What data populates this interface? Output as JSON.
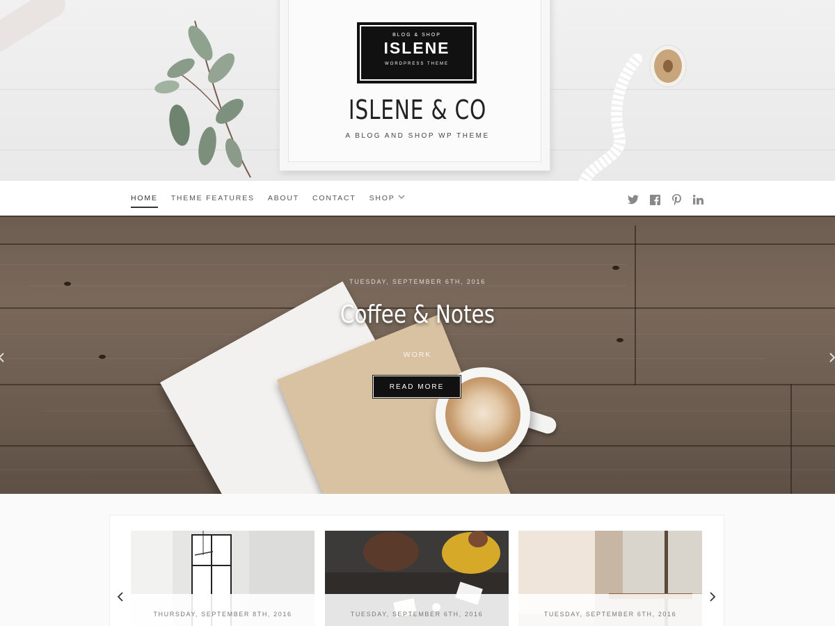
{
  "header": {
    "logo": {
      "top": "BLOG & SHOP",
      "main": "ISLENE",
      "bottom": "WORDPRESS THEME"
    },
    "site_title": "ISLENE & CO",
    "tagline": "A BLOG AND SHOP WP THEME"
  },
  "nav": {
    "items": [
      {
        "label": "HOME",
        "active": true
      },
      {
        "label": "THEME FEATURES",
        "active": false
      },
      {
        "label": "ABOUT",
        "active": false
      },
      {
        "label": "CONTACT",
        "active": false
      },
      {
        "label": "SHOP",
        "active": false,
        "has_dropdown": true
      }
    ],
    "social": [
      "twitter-icon",
      "facebook-icon",
      "pinterest-icon",
      "linkedin-icon"
    ]
  },
  "hero": {
    "date": "TUESDAY, SEPTEMBER 6TH, 2016",
    "title": "Coffee & Notes",
    "category": "WORK",
    "button": "READ MORE"
  },
  "featured": {
    "posts": [
      {
        "date": "THURSDAY, SEPTEMBER 8TH, 2016"
      },
      {
        "date": "TUESDAY, SEPTEMBER 6TH, 2016"
      },
      {
        "date": "TUESDAY, SEPTEMBER 6TH, 2016"
      }
    ]
  },
  "colors": {
    "accent_dark": "#111111",
    "nav_text": "#555555",
    "wood": "#6f5f52",
    "background": "#fafafa"
  }
}
